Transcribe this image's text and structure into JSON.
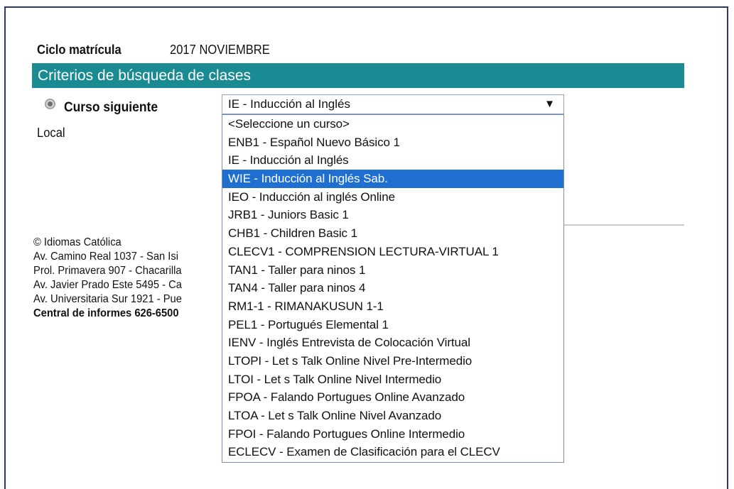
{
  "cycle": {
    "label": "Ciclo matrícula",
    "value": "2017 NOVIEMBRE"
  },
  "criteria_header": "Criterios de búsqueda de clases",
  "radio_label": "Curso siguiente",
  "local_label": "Local",
  "course_select": {
    "selected": "IE - Inducción al Inglés",
    "arrow": "▼",
    "highlighted_index": 3,
    "options": [
      "<Seleccione un curso>",
      "ENB1 - Español Nuevo Básico 1",
      "IE - Inducción al Inglés",
      "WIE - Inducción al Inglés Sab.",
      "IEO - Inducción al inglés Online",
      "JRB1 - Juniors Basic 1",
      "CHB1 - Children Basic 1",
      "CLECV1 - COMPRENSION LECTURA-VIRTUAL 1",
      "TAN1 - Taller para ninos 1",
      "TAN4 - Taller para ninos 4",
      "RM1-1 - RIMANAKUSUN 1-1",
      "PEL1 - Portugués Elemental 1",
      "IENV - Inglés Entrevista de Colocación Virtual",
      "LTOPI - Let s Talk Online Nivel Pre-Intermedio",
      "LTOI - Let s Talk Online Nivel Intermedio",
      "FPOA - Falando Portugues Online Avanzado",
      "LTOA - Let s Talk Online Nivel Avanzado",
      "FPOI - Falando Portugues Online Intermedio",
      "ECLECV - Examen de Clasificación para el CLECV"
    ]
  },
  "footer": {
    "lines": [
      "© Idiomas Católica",
      "Av. Camino Real 1037 - San Isi",
      "Prol. Primavera 907 - Chacarilla",
      "Av. Javier Prado Este 5495 - Ca",
      "Av. Universitaria Sur 1921 - Pue"
    ],
    "phone": "Central de informes 626-6500"
  },
  "colors": {
    "header_bg": "#1a8a93",
    "highlight": "#1e6fd0",
    "frame": "#2b3a6b"
  }
}
